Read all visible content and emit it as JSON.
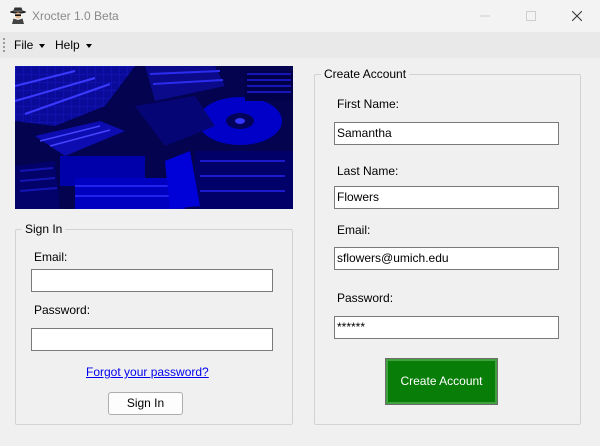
{
  "window": {
    "title": "Xrocter 1.0 Beta",
    "icon": "spy-agent-icon"
  },
  "menu": {
    "file_label": "File",
    "help_label": "Help"
  },
  "sign_in": {
    "group_title": "Sign In",
    "email_label": "Email:",
    "email_value": "",
    "password_label": "Password:",
    "password_value": "",
    "forgot_link": "Forgot your password?",
    "button_label": "Sign In"
  },
  "create_account": {
    "group_title": "Create Account",
    "first_name_label": "First Name:",
    "first_name_value": "Samantha",
    "last_name_label": "Last Name:",
    "last_name_value": "Flowers",
    "email_label": "Email:",
    "email_value": "sflowers@umich.edu",
    "password_label": "Password:",
    "password_value": "******",
    "button_label": "Create Account"
  },
  "colors": {
    "create_button": "#087d08",
    "link": "#0000ee",
    "banner": "#020240"
  }
}
